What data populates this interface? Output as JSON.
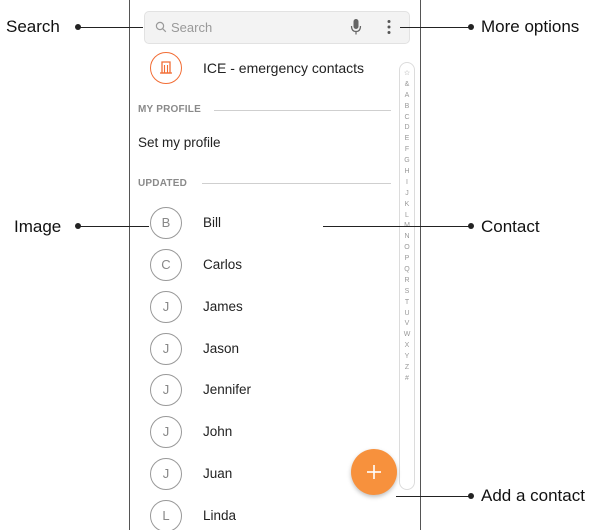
{
  "search": {
    "placeholder": "Search"
  },
  "ice": {
    "label": "ICE - emergency contacts"
  },
  "sections": {
    "my_profile": "MY PROFILE",
    "updated": "UPDATED"
  },
  "profile": {
    "set_label": "Set my profile"
  },
  "contacts": [
    {
      "initial": "B",
      "name": "Bill"
    },
    {
      "initial": "C",
      "name": "Carlos"
    },
    {
      "initial": "J",
      "name": "James"
    },
    {
      "initial": "J",
      "name": "Jason"
    },
    {
      "initial": "J",
      "name": "Jennifer"
    },
    {
      "initial": "J",
      "name": "John"
    },
    {
      "initial": "J",
      "name": "Juan"
    },
    {
      "initial": "L",
      "name": "Linda"
    }
  ],
  "index_letters": [
    "☆",
    "&",
    "A",
    "B",
    "C",
    "D",
    "E",
    "F",
    "G",
    "H",
    "I",
    "J",
    "K",
    "L",
    "M",
    "N",
    "O",
    "P",
    "Q",
    "R",
    "S",
    "T",
    "U",
    "V",
    "W",
    "X",
    "Y",
    "Z",
    "#"
  ],
  "callouts": {
    "search": "Search",
    "more_options": "More options",
    "image": "Image",
    "contact": "Contact",
    "add_contact": "Add a contact"
  },
  "colors": {
    "accent": "#f7913d",
    "ice": "#f26d35"
  },
  "icons": {
    "search": "search-icon",
    "mic": "mic-icon",
    "more": "more-options-icon",
    "ice": "ice-icon",
    "add": "plus-icon"
  }
}
